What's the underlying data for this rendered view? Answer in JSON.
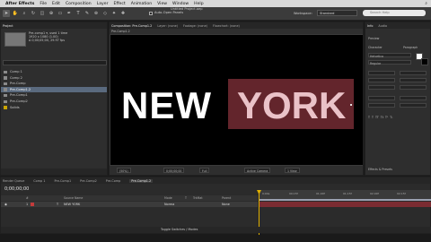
{
  "menubar": {
    "app": "After Effects",
    "items": [
      "File",
      "Edit",
      "Composition",
      "Layer",
      "Effect",
      "Animation",
      "View",
      "Window",
      "Help"
    ]
  },
  "toolbar": {
    "auto_open_label": "Auto-Open Panels",
    "file_title": "Untitled Project.aep",
    "workspace_label": "Workspace:",
    "workspace_value": "Standard",
    "search_placeholder": "Search Help"
  },
  "project": {
    "tab": "Project",
    "info_lines": [
      "Pre-comp1 ▾, used 1 time",
      "1920 x 1080 (1.00)",
      "Δ 0;00;05;00, 29.97 fps"
    ],
    "items": [
      {
        "label": "Comp 1",
        "color": "#8a8a8a"
      },
      {
        "label": "Comp 2",
        "color": "#8a8a8a"
      },
      {
        "label": "Pre-Comp",
        "color": "#8a8a8a"
      },
      {
        "label": "Pre-Comp1.2",
        "color": "#8a8a8a"
      },
      {
        "label": "Pre-Comp1",
        "color": "#8a8a8a"
      },
      {
        "label": "Pre-Comp2",
        "color": "#8a8a8a"
      },
      {
        "label": "Solids",
        "color": "#c9a400"
      }
    ]
  },
  "viewer": {
    "tabs": [
      "Composition: Pre-Comp1.2",
      "Layer: (none)",
      "Footage: (none)",
      "Flowchart: (none)"
    ],
    "sub_tab": "Pre-Comp1.2",
    "text_white": "NEW",
    "text_pink": "YORK",
    "zoom": "(50%)",
    "resolution": "Full",
    "camera": "Active Camera",
    "view": "1 View",
    "timecode": "0;00;00;00"
  },
  "right": {
    "tabs": [
      "Info",
      "Audio"
    ],
    "preview_tab": "Preview",
    "character_tab": "Character",
    "paragraph_tab": "Paragraph",
    "effects_tab": "Effects & Presets",
    "font": "Helvetica",
    "style": "Regular"
  },
  "timeline": {
    "tabs": [
      "Render Queue",
      "Comp 1",
      "Pre-Comp1",
      "Pre-Comp2",
      "Pre-Comp",
      "Pre-Comp1.2"
    ],
    "active_tab_index": 5,
    "timecode": "0;00;00;00",
    "header_cols": [
      "#",
      "Source Name",
      "Mode",
      "T",
      "TrkMat",
      "Parent"
    ],
    "layer": {
      "num": "1",
      "name": "NEW YORK",
      "mode": "Norma",
      "parent": "None"
    },
    "ruler_ticks": [
      "0;00s",
      "00;15f",
      "01;00f",
      "01;15f",
      "02;00f",
      "02;15f"
    ],
    "footer_label": "Toggle Switches / Modes"
  }
}
